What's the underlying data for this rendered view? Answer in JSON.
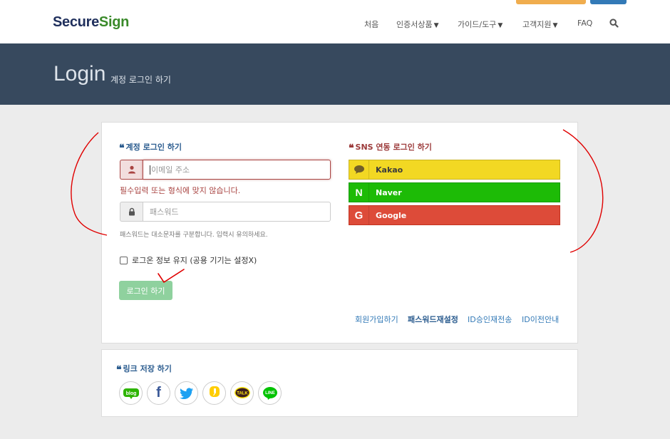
{
  "header": {
    "logo_part1": "Secure",
    "logo_part2": "Sign",
    "nav": [
      "처음",
      "인증서상품",
      "가이드/도구",
      "고객지원",
      "FAQ"
    ]
  },
  "banner": {
    "title": "Login",
    "subtitle": "계정 로그인 하기"
  },
  "login": {
    "section_title": "계정 로그인 하기",
    "email_placeholder": "이메일 주소",
    "email_error": "필수입력 또는 형식에 맞지 않습니다.",
    "password_placeholder": "패스워드",
    "password_help": "패스워드는 대소문자를 구분합니다. 입력시 유의하세요.",
    "remember_label": "로그온 정보 유지 (공용 기기는 설정X)",
    "submit_label": "로그인 하기",
    "links": {
      "signup": "회원가입하기",
      "reset_password": "패스워드재설정",
      "resend_id": "ID승인재전송",
      "id_transfer": "ID이전안내"
    }
  },
  "sns": {
    "section_title": "SNS 연동 로그인 하기",
    "kakao": "Kakao",
    "naver": "Naver",
    "naver_icon": "N",
    "google": "Google",
    "google_icon": "G"
  },
  "share": {
    "section_title": "링크 저장 하기",
    "blog_text": "blog",
    "facebook_text": "f",
    "talk_text": "TALK",
    "line_text": "LINE"
  },
  "colors": {
    "banner_bg": "#37495e",
    "kakao": "#f2d823",
    "naver": "#1dbb06",
    "google": "#dd4b39",
    "login_button": "#8fd19e",
    "error": "#a94442",
    "annotation": "#e00000"
  }
}
